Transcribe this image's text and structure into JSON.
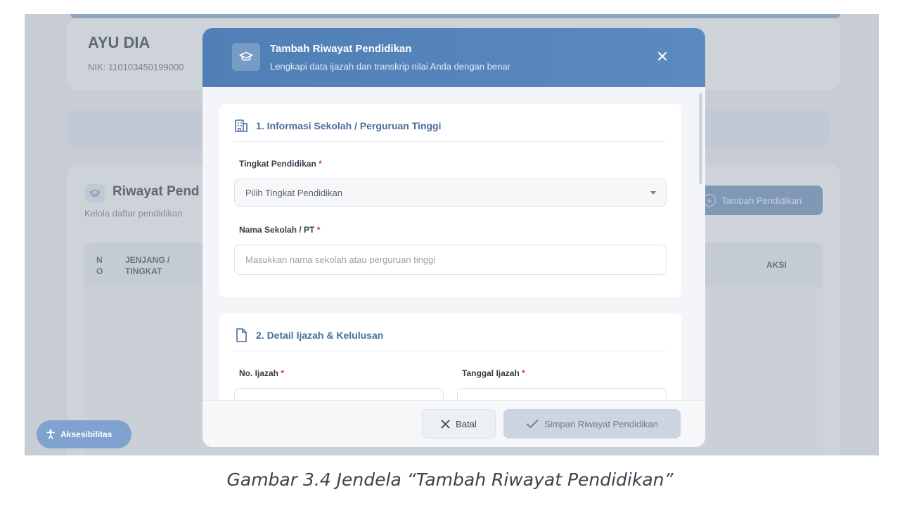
{
  "background": {
    "profile": {
      "name": "AYU DIA",
      "nik": "NIK: 110103450199000"
    },
    "list": {
      "title": "Riwayat Pend",
      "subtitle": "Kelola daftar pendidikan",
      "add_button": "Tambah Pendidikan",
      "columns": {
        "no": "NO",
        "jenjang": "JENJANG /",
        "tingkat": "TINGKAT",
        "aksi": "AKSI"
      }
    },
    "accessibility_button": "Aksesibilitas"
  },
  "modal": {
    "title": "Tambah Riwayat Pendidikan",
    "subtitle": "Lengkapi data ijazah dan transkrip nilai Anda dengan benar",
    "section1": {
      "title": "1. Informasi Sekolah / Perguruan Tinggi",
      "tingkat_label": "Tingkat Pendidikan",
      "tingkat_selected": "Pilih Tingkat Pendidikan",
      "nama_label": "Nama Sekolah / PT",
      "nama_placeholder": "Masukkan nama sekolah atau perguruan tinggi"
    },
    "section2": {
      "title": "2. Detail Ijazah & Kelulusan",
      "no_ijazah_label": "No. Ijazah",
      "tanggal_label": "Tanggal Ijazah"
    },
    "required_mark": "*",
    "footer": {
      "cancel": "Batal",
      "save": "Simpan Riwayat Pendidikan"
    }
  },
  "caption": "Gambar 3.4 Jendela “Tambah Riwayat Pendidikan”",
  "colors": {
    "header": "#5484bb",
    "accent": "#4a6e9a",
    "required": "#d23b3b"
  }
}
